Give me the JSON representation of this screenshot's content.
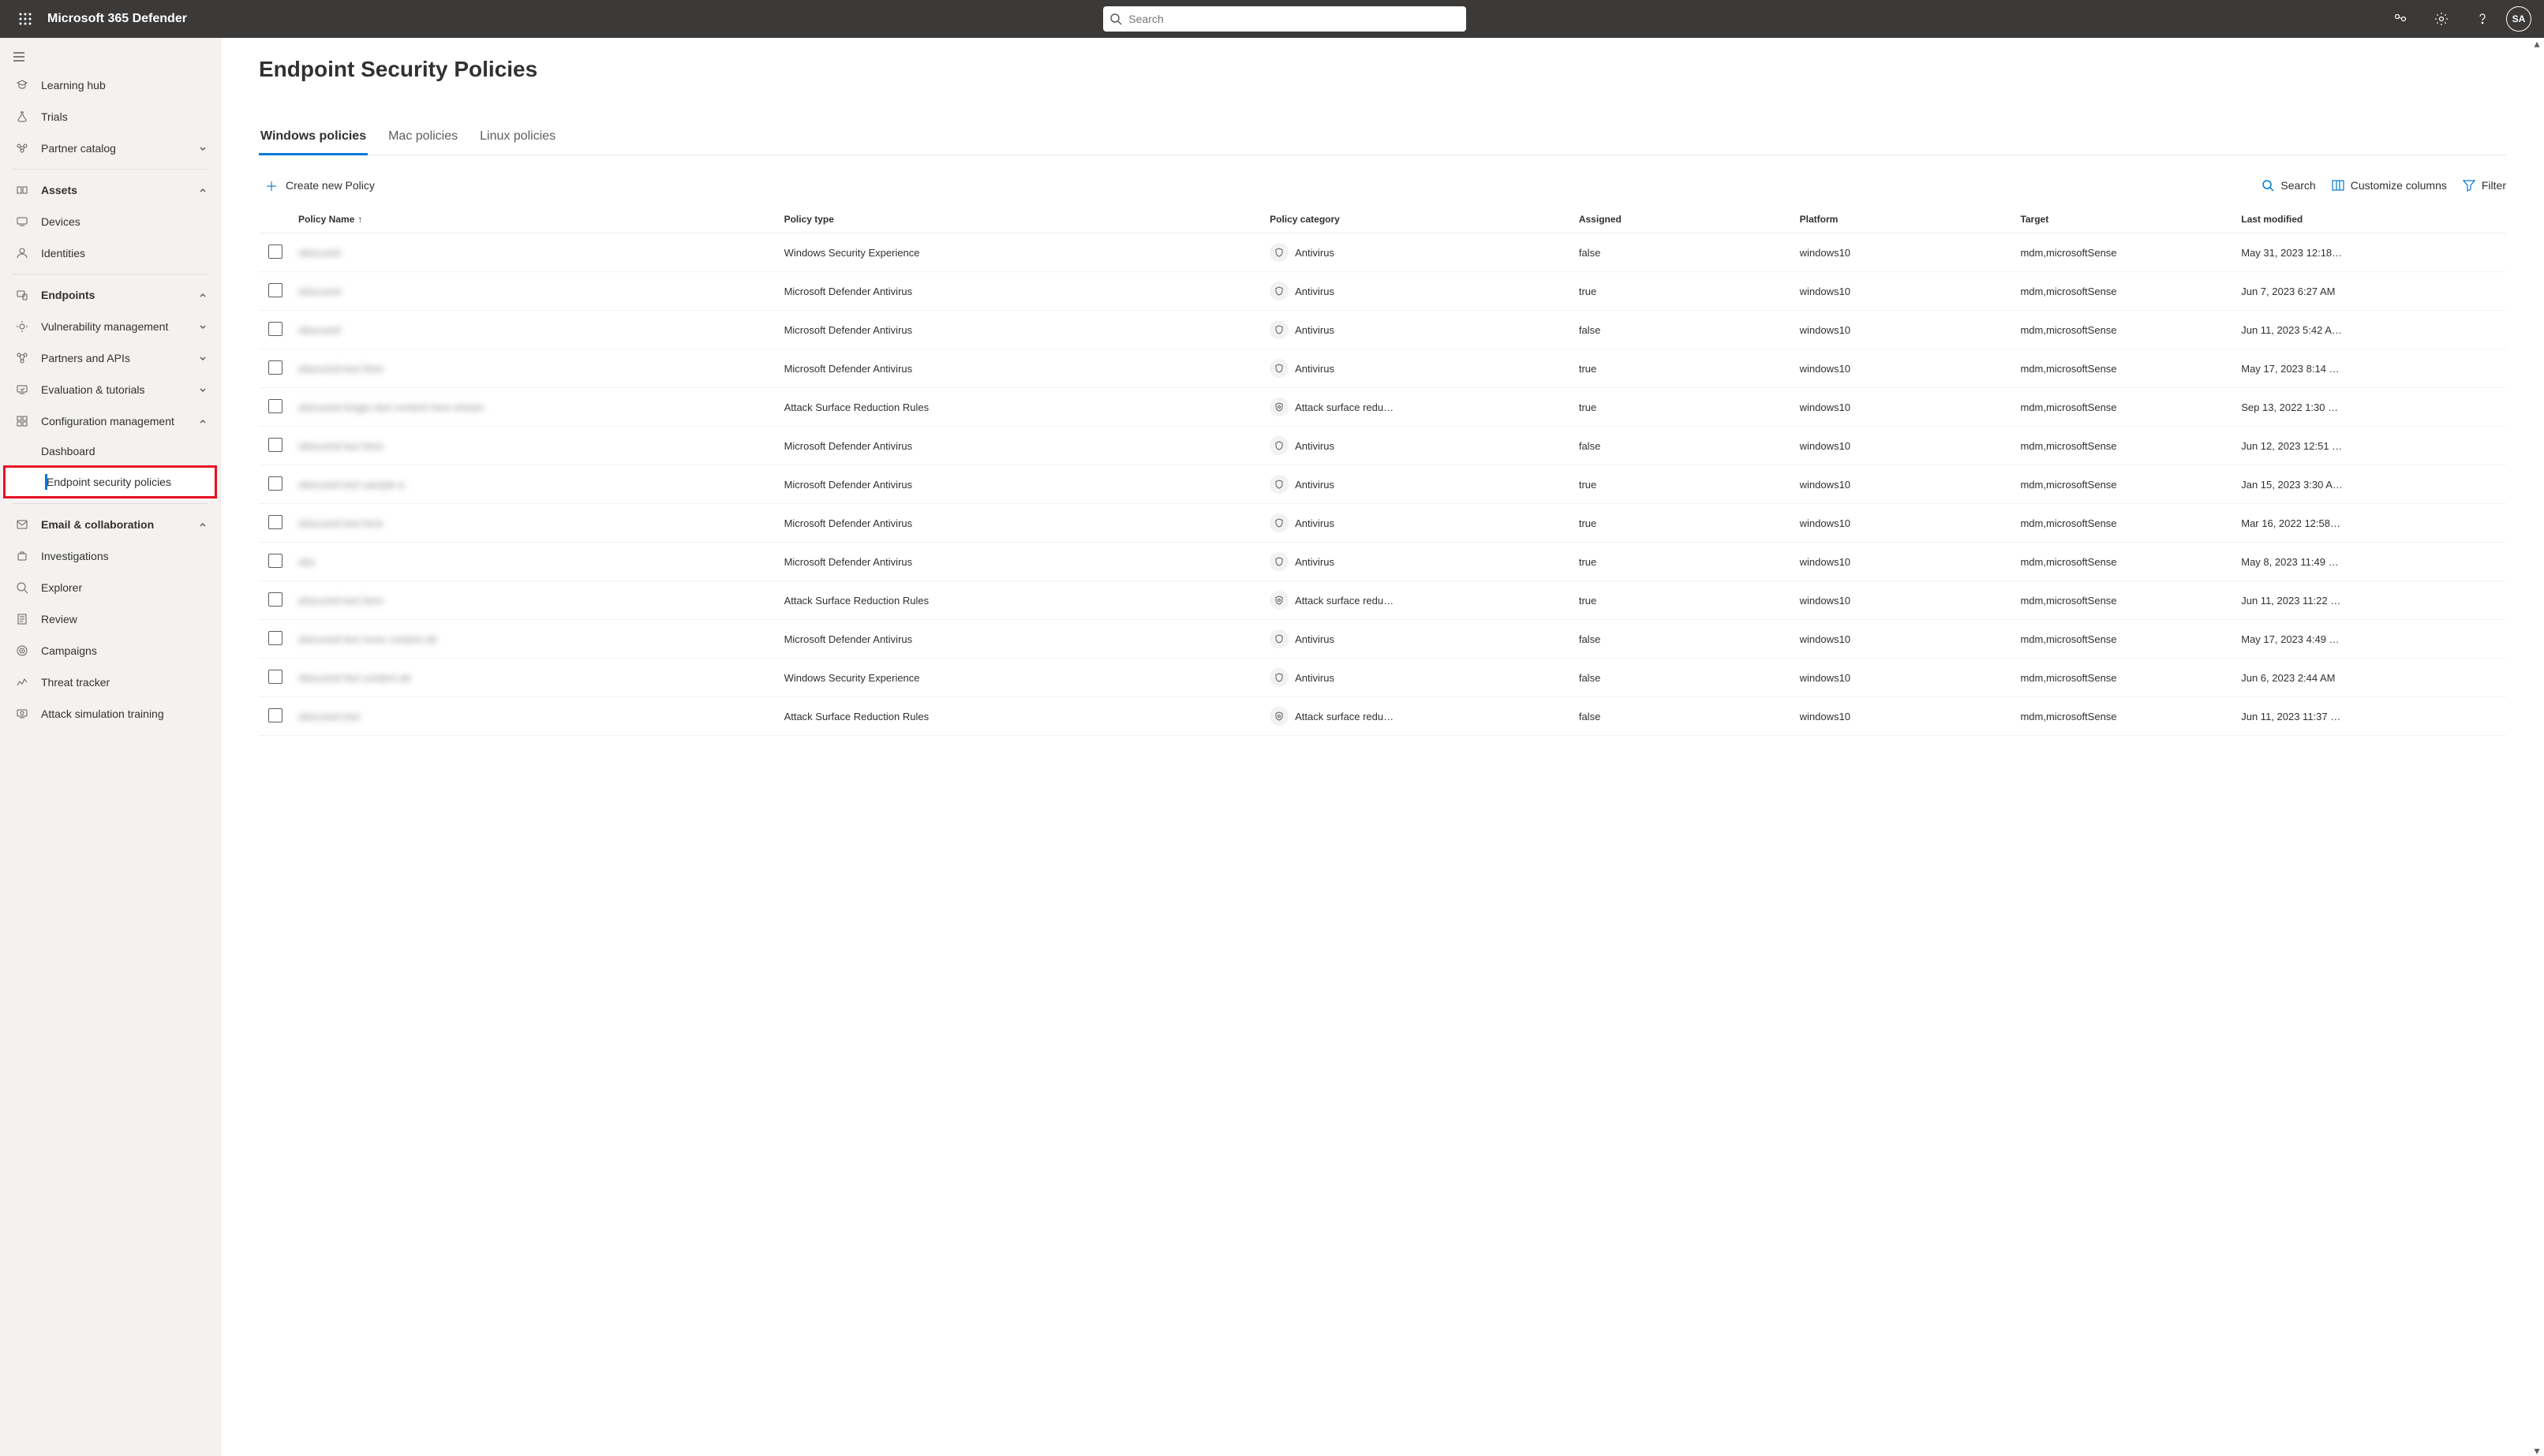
{
  "header": {
    "brand": "Microsoft 365 Defender",
    "search_placeholder": "Search",
    "avatar_initials": "SA"
  },
  "sidebar": {
    "items": [
      {
        "icon": "learning",
        "label": "Learning hub"
      },
      {
        "icon": "trials",
        "label": "Trials"
      },
      {
        "icon": "partner",
        "label": "Partner catalog",
        "expandable": true
      },
      {
        "sep": true
      },
      {
        "icon": "assets",
        "label": "Assets",
        "bold": true,
        "expandable": true,
        "expanded": true
      },
      {
        "icon": "devices",
        "label": "Devices"
      },
      {
        "icon": "identities",
        "label": "Identities"
      },
      {
        "sep": true
      },
      {
        "icon": "endpoints",
        "label": "Endpoints",
        "bold": true,
        "expandable": true,
        "expanded": true
      },
      {
        "icon": "vuln",
        "label": "Vulnerability management",
        "expandable": true
      },
      {
        "icon": "api",
        "label": "Partners and APIs",
        "expandable": true
      },
      {
        "icon": "eval",
        "label": "Evaluation & tutorials",
        "expandable": true
      },
      {
        "icon": "config",
        "label": "Configuration management",
        "expandable": true,
        "expanded": true
      },
      {
        "sub": true,
        "label": "Dashboard"
      },
      {
        "sub": true,
        "label": "Endpoint security policies",
        "selected": true,
        "highlight": true
      },
      {
        "sep": true
      },
      {
        "icon": "email",
        "label": "Email & collaboration",
        "bold": true,
        "expandable": true,
        "expanded": true
      },
      {
        "icon": "investigations",
        "label": "Investigations"
      },
      {
        "icon": "explorer",
        "label": "Explorer"
      },
      {
        "icon": "review",
        "label": "Review"
      },
      {
        "icon": "campaigns",
        "label": "Campaigns"
      },
      {
        "icon": "threat",
        "label": "Threat tracker"
      },
      {
        "icon": "attack",
        "label": "Attack simulation training"
      }
    ]
  },
  "page": {
    "title": "Endpoint Security Policies",
    "tabs": [
      {
        "label": "Windows policies",
        "active": true
      },
      {
        "label": "Mac policies"
      },
      {
        "label": "Linux policies"
      }
    ],
    "toolbar": {
      "create_label": "Create new Policy",
      "search_label": "Search",
      "columns_label": "Customize columns",
      "filter_label": "Filter"
    },
    "columns": {
      "name": "Policy Name",
      "type": "Policy type",
      "category": "Policy category",
      "assigned": "Assigned",
      "platform": "Platform",
      "target": "Target",
      "modified": "Last modified"
    },
    "rows": [
      {
        "name": "obscured",
        "type": "Windows Security Experience",
        "category": "Antivirus",
        "cat_icon": "shield",
        "assigned": "false",
        "platform": "windows10",
        "target": "mdm,microsoftSense",
        "modified": "May 31, 2023 12:18…"
      },
      {
        "name": "obscured",
        "type": "Microsoft Defender Antivirus",
        "category": "Antivirus",
        "cat_icon": "shield",
        "assigned": "true",
        "platform": "windows10",
        "target": "mdm,microsoftSense",
        "modified": "Jun 7, 2023 6:27 AM"
      },
      {
        "name": "obscured",
        "type": "Microsoft Defender Antivirus",
        "category": "Antivirus",
        "cat_icon": "shield",
        "assigned": "false",
        "platform": "windows10",
        "target": "mdm,microsoftSense",
        "modified": "Jun 11, 2023 5:42 A…"
      },
      {
        "name": "obscured text here",
        "type": "Microsoft Defender Antivirus",
        "category": "Antivirus",
        "cat_icon": "shield",
        "assigned": "true",
        "platform": "windows10",
        "target": "mdm,microsoftSense",
        "modified": "May 17, 2023 8:14 …"
      },
      {
        "name": "obscured longer text content here shown",
        "type": "Attack Surface Reduction Rules",
        "category": "Attack surface redu…",
        "cat_icon": "asr",
        "assigned": "true",
        "platform": "windows10",
        "target": "mdm,microsoftSense",
        "modified": "Sep 13, 2022 1:30 …"
      },
      {
        "name": "obscured text here",
        "type": "Microsoft Defender Antivirus",
        "category": "Antivirus",
        "cat_icon": "shield",
        "assigned": "false",
        "platform": "windows10",
        "target": "mdm,microsoftSense",
        "modified": "Jun 12, 2023 12:51 …"
      },
      {
        "name": "obscured text sample a",
        "type": "Microsoft Defender Antivirus",
        "category": "Antivirus",
        "cat_icon": "shield",
        "assigned": "true",
        "platform": "windows10",
        "target": "mdm,microsoftSense",
        "modified": "Jan 15, 2023 3:30 A…"
      },
      {
        "name": "obscured text here",
        "type": "Microsoft Defender Antivirus",
        "category": "Antivirus",
        "cat_icon": "shield",
        "assigned": "true",
        "platform": "windows10",
        "target": "mdm,microsoftSense",
        "modified": "Mar 16, 2022 12:58…"
      },
      {
        "name": "obs",
        "type": "Microsoft Defender Antivirus",
        "category": "Antivirus",
        "cat_icon": "shield",
        "assigned": "true",
        "platform": "windows10",
        "target": "mdm,microsoftSense",
        "modified": "May 8, 2023 11:49 …"
      },
      {
        "name": "obscured text here",
        "type": "Attack Surface Reduction Rules",
        "category": "Attack surface redu…",
        "cat_icon": "asr",
        "assigned": "true",
        "platform": "windows10",
        "target": "mdm,microsoftSense",
        "modified": "Jun 11, 2023 11:22 …"
      },
      {
        "name": "obscured text more content ab",
        "type": "Microsoft Defender Antivirus",
        "category": "Antivirus",
        "cat_icon": "shield",
        "assigned": "false",
        "platform": "windows10",
        "target": "mdm,microsoftSense",
        "modified": "May 17, 2023 4:49 …"
      },
      {
        "name": "obscured text content ab",
        "type": "Windows Security Experience",
        "category": "Antivirus",
        "cat_icon": "shield",
        "assigned": "false",
        "platform": "windows10",
        "target": "mdm,microsoftSense",
        "modified": "Jun 6, 2023 2:44 AM"
      },
      {
        "name": "obscured text",
        "type": "Attack Surface Reduction Rules",
        "category": "Attack surface redu…",
        "cat_icon": "asr",
        "assigned": "false",
        "platform": "windows10",
        "target": "mdm,microsoftSense",
        "modified": "Jun 11, 2023 11:37 …"
      }
    ]
  }
}
